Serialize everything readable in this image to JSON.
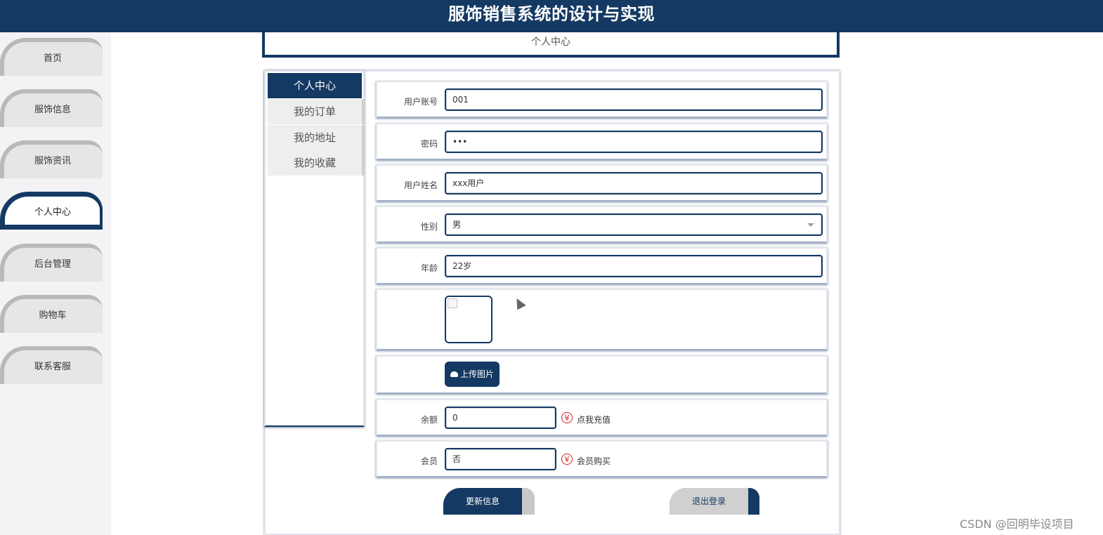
{
  "app": {
    "title": "服饰销售系统的设计与实现"
  },
  "sidebar": {
    "items": [
      {
        "label": "首页"
      },
      {
        "label": "服饰信息"
      },
      {
        "label": "服饰资讯"
      },
      {
        "label": "个人中心"
      },
      {
        "label": "后台管理"
      },
      {
        "label": "购物车"
      },
      {
        "label": "联系客服"
      }
    ],
    "active": "个人中心"
  },
  "page": {
    "header": "个人中心"
  },
  "submenu": {
    "items": [
      {
        "label": "个人中心"
      },
      {
        "label": "我的订单"
      },
      {
        "label": "我的地址"
      },
      {
        "label": "我的收藏"
      }
    ]
  },
  "form": {
    "account": {
      "label": "用户账号",
      "value": "001"
    },
    "password": {
      "label": "密码",
      "value": "•••"
    },
    "name": {
      "label": "用户姓名",
      "value": "xxx用户"
    },
    "gender": {
      "label": "性别",
      "value": "男"
    },
    "age": {
      "label": "年龄",
      "value": "22岁"
    },
    "upload_label": "上传图片",
    "balance": {
      "label": "余额",
      "value": "0",
      "action": "点我充值"
    },
    "member": {
      "label": "会员",
      "value": "否",
      "action": "会员购买"
    }
  },
  "buttons": {
    "update": "更新信息",
    "logout": "退出登录"
  },
  "icons": {
    "upload": "cloud-upload-icon",
    "yen": "yen-icon",
    "yen_symbol": "¥",
    "select": "chevron-down-icon"
  },
  "watermark": "CSDN @回明毕设项目",
  "colors": {
    "primary": "#143963",
    "accent": "#e02020"
  }
}
